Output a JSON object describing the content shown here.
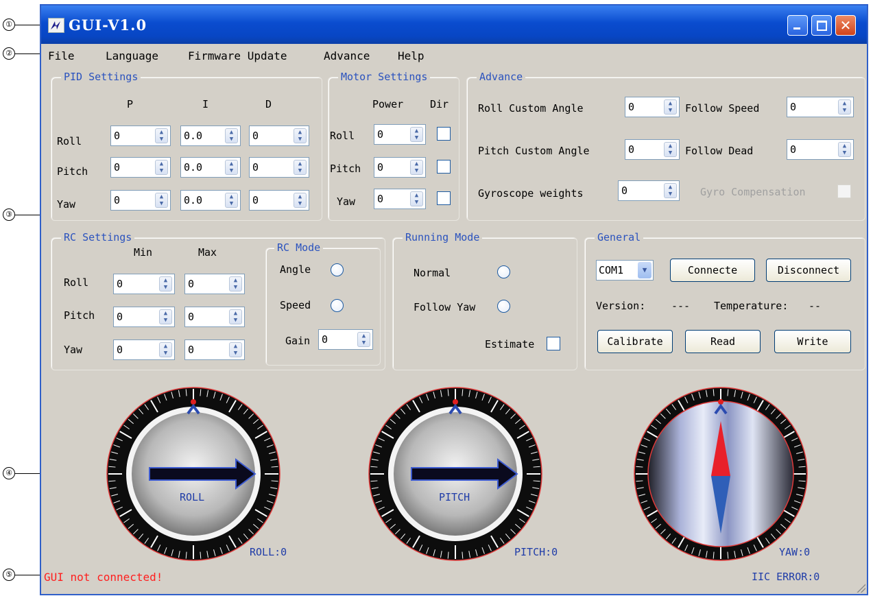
{
  "annotations": [
    "①",
    "②",
    "③",
    "④",
    "⑤"
  ],
  "window": {
    "title": "GUI-V1.0",
    "controls": {
      "minimize": "minimize-icon",
      "maximize": "maximize-icon",
      "close": "✕"
    }
  },
  "menu": {
    "file": "File",
    "language": "Language",
    "firmware": "Firmware Update",
    "advance": "Advance",
    "help": "Help"
  },
  "pid": {
    "title": "PID Settings",
    "col_p": "P",
    "col_i": "I",
    "col_d": "D",
    "rows": [
      {
        "label": "Roll",
        "p": "0",
        "i": "0.0",
        "d": "0"
      },
      {
        "label": "Pitch",
        "p": "0",
        "i": "0.0",
        "d": "0"
      },
      {
        "label": "Yaw",
        "p": "0",
        "i": "0.0",
        "d": "0"
      }
    ]
  },
  "motor": {
    "title": "Motor Settings",
    "col_power": "Power",
    "col_dir": "Dir",
    "rows": [
      {
        "label": "Roll",
        "power": "0"
      },
      {
        "label": "Pitch",
        "power": "0"
      },
      {
        "label": "Yaw",
        "power": "0"
      }
    ]
  },
  "advance": {
    "title": "Advance",
    "roll_custom_angle_label": "Roll  Custom Angle",
    "roll_custom_angle": "0",
    "follow_speed_label": "Follow Speed",
    "follow_speed": "0",
    "pitch_custom_angle_label": "Pitch Custom Angle",
    "pitch_custom_angle": "0",
    "follow_dead_label": "Follow Dead",
    "follow_dead": "0",
    "gyro_weights_label": "Gyroscope weights",
    "gyro_weights": "0",
    "gyro_comp_label": "Gyro Compensation"
  },
  "rc": {
    "title": "RC Settings",
    "col_min": "Min",
    "col_max": "Max",
    "rows": [
      {
        "label": "Roll",
        "min": "0",
        "max": "0"
      },
      {
        "label": "Pitch",
        "min": "0",
        "max": "0"
      },
      {
        "label": "Yaw",
        "min": "0",
        "max": "0"
      }
    ]
  },
  "rc_mode": {
    "title": "RC Mode",
    "angle": "Angle",
    "speed": "Speed",
    "gain_label": "Gain",
    "gain": "0"
  },
  "running": {
    "title": "Running Mode",
    "normal": "Normal",
    "follow_yaw": "Follow Yaw",
    "estimate": "Estimate"
  },
  "general": {
    "title": "General",
    "port": "COM1",
    "connect": "Connecte",
    "disconnect": "Disconnect",
    "version_label": "Version:",
    "version_value": "---",
    "temperature_label": "Temperature:",
    "temperature_value": "--",
    "calibrate": "Calibrate",
    "read": "Read",
    "write": "Write"
  },
  "dials": {
    "roll_center": "ROLL",
    "roll_readout": "ROLL:0",
    "pitch_center": "PITCH",
    "pitch_readout": "PITCH:0",
    "yaw_readout": "YAW:0"
  },
  "status": "GUI not connected!",
  "iic_error": "IIC ERROR:0",
  "colors": {
    "title_blue": "#0a4ccf",
    "group_title": "#2a52be",
    "status_red": "#ff1e1e",
    "needle_red": "#e8202a",
    "needle_blue": "#2f5fb8"
  }
}
